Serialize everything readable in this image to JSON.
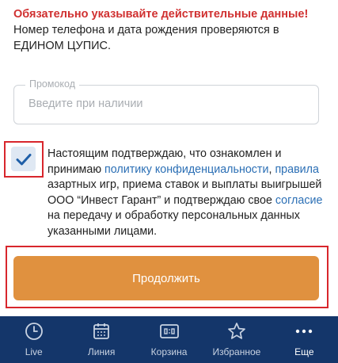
{
  "notice": {
    "warning": "Обязательно указывайте действительные данные!",
    "info": "Номер телефона и дата рождения проверяются в ЕДИНОМ ЦУПИС."
  },
  "promo": {
    "legend": "Промокод",
    "placeholder": "Введите при наличии",
    "value": ""
  },
  "consent": {
    "checked": true,
    "part1": "Настоящим подтверждаю, что ознакомлен и принимаю ",
    "link_privacy": "политику конфиденциальности",
    "comma": ", ",
    "link_rules": "правила",
    "part2": " азартных игр, приема ставок и выплаты выигрышей ООО “Инвест Гарант” и подтверждаю свое ",
    "link_consent": "согласие",
    "part3": " на передачу и обработку персональных данных указанными лицами."
  },
  "button": {
    "label": "Продолжить"
  },
  "tabbar": {
    "items": [
      {
        "label": "Live",
        "icon": "clock-icon"
      },
      {
        "label": "Линия",
        "icon": "calendar-icon"
      },
      {
        "label": "Корзина",
        "icon": "coupon-icon"
      },
      {
        "label": "Избранное",
        "icon": "star-icon"
      },
      {
        "label": "Еще",
        "icon": "more-icon"
      }
    ],
    "active_index": 4
  },
  "colors": {
    "warning": "#d03030",
    "link": "#2b6fb5",
    "button": "#e0913f",
    "tabbar": "#14366a",
    "highlight": "#d8262c"
  }
}
